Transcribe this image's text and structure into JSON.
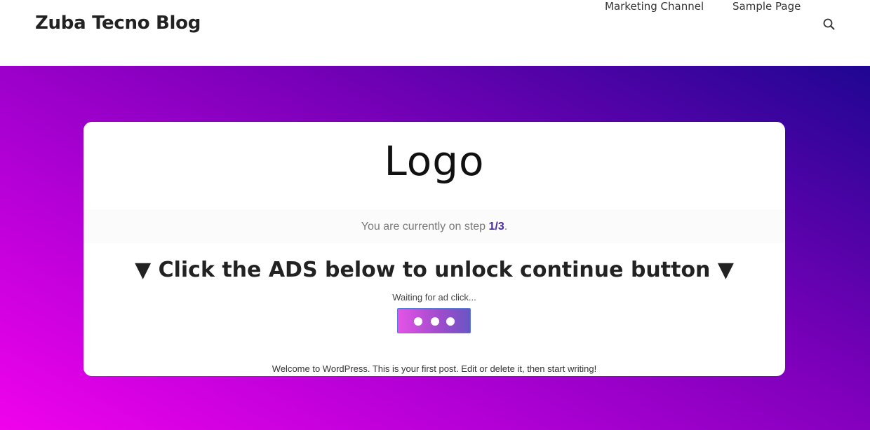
{
  "header": {
    "site_title": "Zuba Tecno Blog",
    "nav": {
      "marketing": "Marketing Channel",
      "sample": "Sample Page"
    },
    "search_icon": "search-icon"
  },
  "colors": {
    "gradient_start": "#f002ec",
    "gradient_end": "#1f0692",
    "step_accent": "#4b2aa6"
  },
  "card": {
    "logo": "Logo",
    "step_prefix": "You are currently on step ",
    "step_value": "1/3",
    "step_suffix": ".",
    "ads_heading": "▼ Click the ADS below to unlock continue button ▼",
    "waiting": "Waiting for ad click...",
    "welcome": "Welcome to WordPress. This is your first post. Edit or delete it, then start writing!"
  }
}
